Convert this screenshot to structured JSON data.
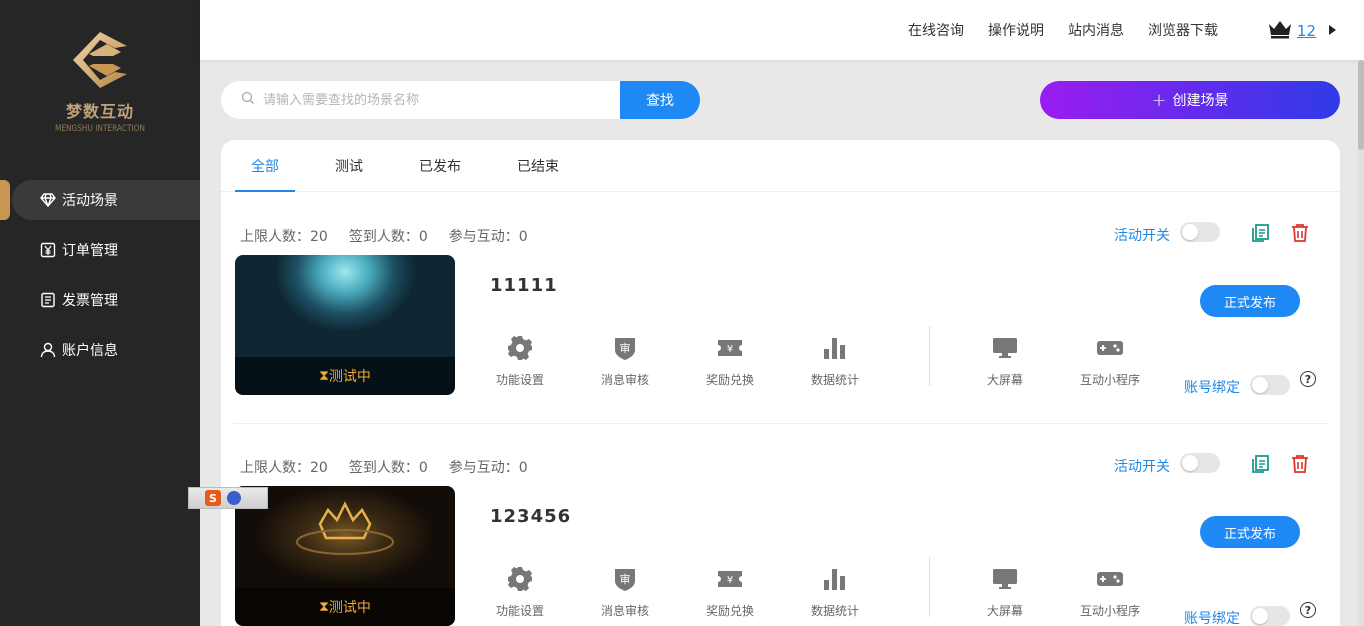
{
  "brand": {
    "name": "梦数互动",
    "sub": "MENGSHU INTERACTION"
  },
  "sidebar": {
    "items": [
      {
        "label": "活动场景",
        "icon": "diamond-icon",
        "active": true
      },
      {
        "label": "订单管理",
        "icon": "receipt-icon",
        "active": false
      },
      {
        "label": "发票管理",
        "icon": "invoice-icon",
        "active": false
      },
      {
        "label": "账户信息",
        "icon": "user-icon",
        "active": false
      }
    ]
  },
  "header": {
    "links": [
      "在线咨询",
      "操作说明",
      "站内消息",
      "浏览器下载"
    ],
    "user_count": "12"
  },
  "search": {
    "placeholder": "请输入需要查找的场景名称",
    "value": "",
    "button": "查找"
  },
  "create_button": "创建场景",
  "tabs": [
    {
      "label": "全部",
      "active": true
    },
    {
      "label": "测试",
      "active": false
    },
    {
      "label": "已发布",
      "active": false
    },
    {
      "label": "已结束",
      "active": false
    }
  ],
  "labels": {
    "activity_switch": "活动开关",
    "publish": "正式发布",
    "account_bind": "账号绑定",
    "help": "?"
  },
  "functions": [
    {
      "label": "功能设置",
      "icon": "gear-icon"
    },
    {
      "label": "消息审核",
      "icon": "review-shield-icon"
    },
    {
      "label": "奖励兑换",
      "icon": "ticket-icon"
    },
    {
      "label": "数据统计",
      "icon": "bar-chart-icon"
    },
    {
      "label": "大屏幕",
      "icon": "monitor-icon"
    },
    {
      "label": "互动小程序",
      "icon": "gamepad-icon"
    }
  ],
  "scenes": [
    {
      "title": "11111",
      "status": "测试中",
      "stats": [
        "上限人数：20",
        "签到人数：0",
        "参与互动：0"
      ]
    },
    {
      "title": "123456",
      "status": "测试中",
      "stats": [
        "上限人数：20",
        "签到人数：0",
        "参与互动：0"
      ]
    }
  ],
  "colors": {
    "accent": "#1e88f5",
    "sidebar": "#262626",
    "brand_gold": "#c99653",
    "status": "#f0a830"
  }
}
